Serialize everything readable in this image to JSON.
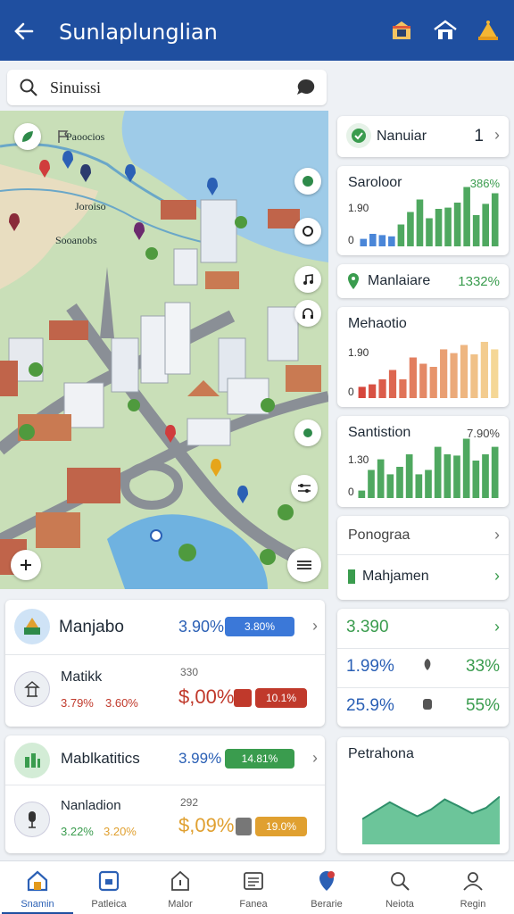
{
  "header": {
    "title": "Sunlaplunglian"
  },
  "search": {
    "value": "Sinuissi",
    "placeholder": "Sinuissi"
  },
  "map": {
    "labels": [
      "Paoocios",
      "Joroiso",
      "Sooanobs"
    ]
  },
  "right_cards": {
    "nanuiar": {
      "label": "Nanuiar",
      "value": "1"
    },
    "saroloor": {
      "label": "Saroloor",
      "value": "386%",
      "tick_top": "1.90",
      "tick_bottom": "0",
      "bars": [
        0.12,
        0.2,
        0.18,
        0.16,
        0.35,
        0.55,
        0.75,
        0.45,
        0.6,
        0.62,
        0.7,
        0.95,
        0.5,
        0.68,
        0.85
      ]
    },
    "manlaiare": {
      "label": "Manlaiare",
      "value": "1332%"
    },
    "mehaotio": {
      "label": "Mehaotio",
      "tick_top": "1.90",
      "tick_bottom": "0",
      "bars": [
        0.18,
        0.22,
        0.3,
        0.45,
        0.3,
        0.65,
        0.55,
        0.5,
        0.78,
        0.72,
        0.85,
        0.7,
        0.9,
        0.78
      ]
    },
    "santistion": {
      "label": "Santistion",
      "value": "7.90%",
      "tick_top": "1.30",
      "tick_bottom": "0",
      "bars": [
        0.12,
        0.45,
        0.62,
        0.38,
        0.5,
        0.7,
        0.38,
        0.45,
        0.82,
        0.7,
        0.68,
        0.95,
        0.6,
        0.7,
        0.82
      ]
    },
    "ponograa": {
      "label": "Ponograa"
    },
    "mahjamen": {
      "label": "Mahjamen"
    },
    "stats": {
      "row1": "3.390",
      "row2_left": "1.99%",
      "row2_right": "33%",
      "row3_left": "25.9%",
      "row3_right": "55%"
    },
    "petrahona": {
      "label": "Petrahona",
      "wave": [
        0.45,
        0.6,
        0.75,
        0.62,
        0.5,
        0.62,
        0.8,
        0.68,
        0.55,
        0.65,
        0.85
      ]
    }
  },
  "left_cards": {
    "card1": {
      "row1": {
        "label": "Manjabo",
        "value": "3.90%",
        "pill": "3.80%"
      },
      "row2": {
        "label": "Matikk",
        "small": "330",
        "sub_left": "3.79%",
        "sub_right": "3.60%",
        "big": "$,00%",
        "pill": "10.1%"
      }
    },
    "card2": {
      "row1": {
        "label": "Mablkatitics",
        "value": "3.99%",
        "pill": "14.81%"
      },
      "row2": {
        "label": "Nanladion",
        "small": "292",
        "sub_left": "3.22%",
        "sub_right": "3.20%",
        "big": "$,09%",
        "pill": "19.0%"
      }
    }
  },
  "bottom_nav": [
    {
      "label": "Snamin"
    },
    {
      "label": "Patleica"
    },
    {
      "label": "Malor"
    },
    {
      "label": "Fanea"
    },
    {
      "label": "Berarie"
    },
    {
      "label": "Neiota"
    },
    {
      "label": "Regin"
    }
  ],
  "colors": {
    "brand": "#1f4fa0",
    "green": "#3a9c4e",
    "red": "#c0392b",
    "blue": "#3b78d8",
    "orange": "#e0a030"
  }
}
